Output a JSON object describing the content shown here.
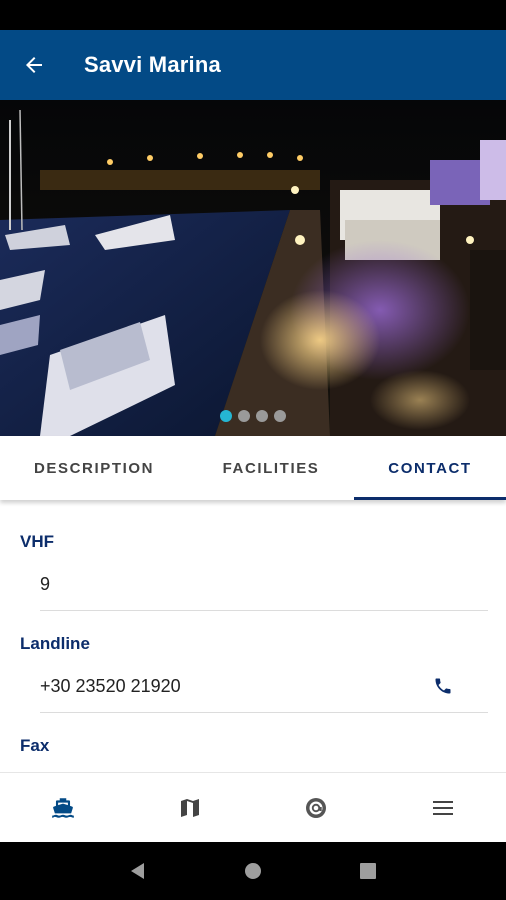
{
  "app_bar": {
    "title": "Savvi Marina"
  },
  "carousel": {
    "image": "marina-night-photo",
    "slide_count": 4,
    "active_index": 0
  },
  "tabs": [
    {
      "label": "DESCRIPTION",
      "active": false
    },
    {
      "label": "FACILITIES",
      "active": false
    },
    {
      "label": "CONTACT",
      "active": true
    }
  ],
  "contact": {
    "vhf": {
      "label": "VHF",
      "value": "9"
    },
    "landline": {
      "label": "Landline",
      "value": "+30 23520 21920",
      "action_icon": "phone-icon"
    },
    "fax": {
      "label": "Fax"
    }
  },
  "bottom_nav": [
    {
      "icon": "boat-icon",
      "active": true
    },
    {
      "icon": "map-icon",
      "active": false
    },
    {
      "icon": "at-sign-icon",
      "active": false
    },
    {
      "icon": "menu-icon",
      "active": false
    }
  ],
  "colors": {
    "primary": "#034a86",
    "accent_text": "#0c2d6b",
    "dot_active": "#25b6d3"
  }
}
